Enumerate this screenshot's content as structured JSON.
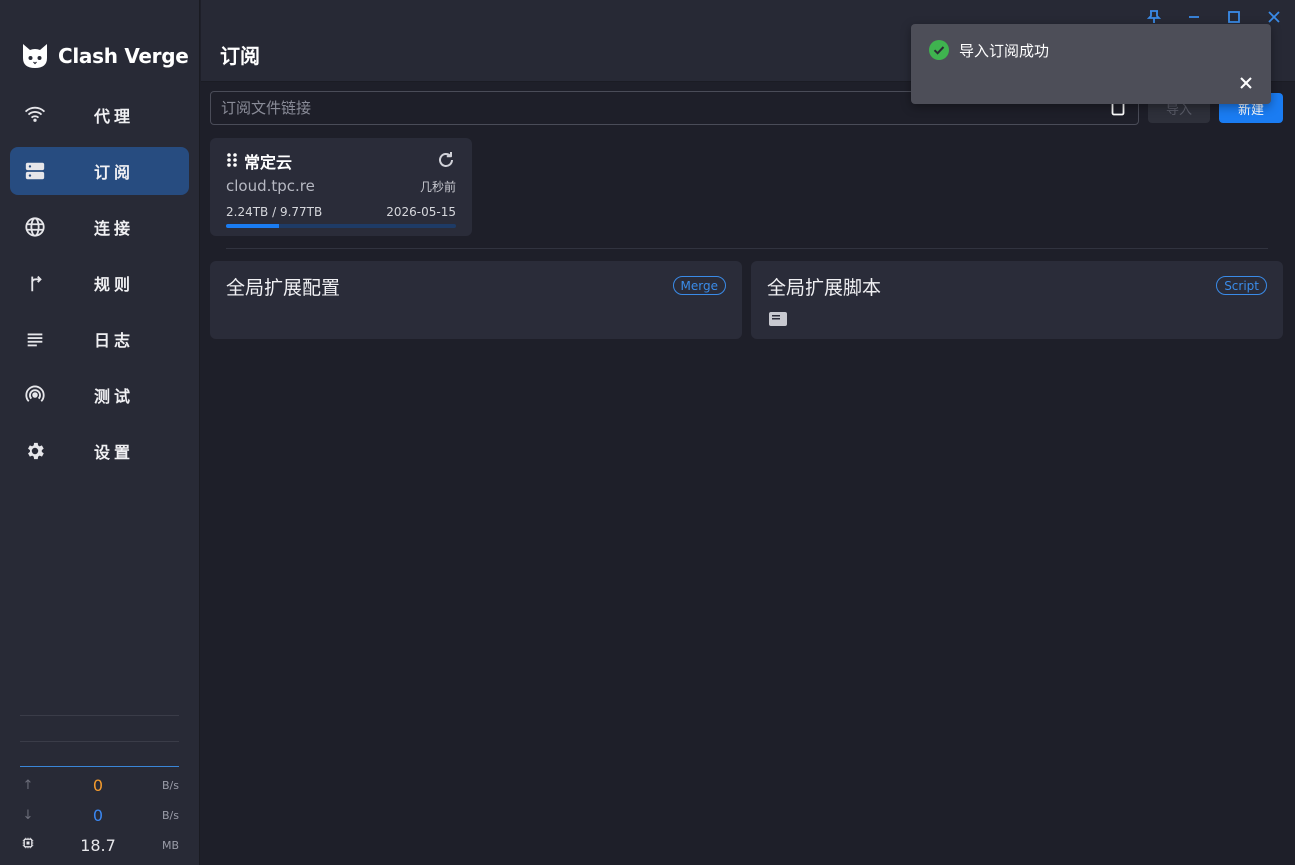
{
  "app": {
    "name": "Clash Verge"
  },
  "sidebar": {
    "items": [
      {
        "label": "代理",
        "icon": "wifi-icon",
        "active": false
      },
      {
        "label": "订阅",
        "icon": "server-icon",
        "active": true
      },
      {
        "label": "连接",
        "icon": "globe-icon",
        "active": false
      },
      {
        "label": "规则",
        "icon": "fork-icon",
        "active": false
      },
      {
        "label": "日志",
        "icon": "lines-icon",
        "active": false
      },
      {
        "label": "测试",
        "icon": "radar-icon",
        "active": false
      },
      {
        "label": "设置",
        "icon": "gear-icon",
        "active": false
      }
    ],
    "traffic": {
      "up": {
        "value": "0",
        "unit": "B/s"
      },
      "down": {
        "value": "0",
        "unit": "B/s"
      },
      "memory": {
        "value": "18.7",
        "unit": "MB"
      }
    }
  },
  "header": {
    "title": "订阅"
  },
  "toolbar": {
    "url_placeholder": "订阅文件链接",
    "url_value": "",
    "import_label": "导入",
    "new_label": "新建"
  },
  "subscription": {
    "name": "常定云",
    "url": "cloud.tpc.re",
    "updated": "几秒前",
    "usage": "2.24TB / 9.77TB",
    "expire": "2026-05-15",
    "usage_fraction": 0.23
  },
  "extensions": [
    {
      "title": "全局扩展配置",
      "badge": "Merge"
    },
    {
      "title": "全局扩展脚本",
      "badge": "Script"
    }
  ],
  "toast": {
    "message": "导入订阅成功"
  },
  "colors": {
    "accent": "#1a7cf2",
    "active_nav": "#274c80",
    "upload": "#f29a2e",
    "download": "#3a86f0",
    "success": "#3fb34f"
  }
}
